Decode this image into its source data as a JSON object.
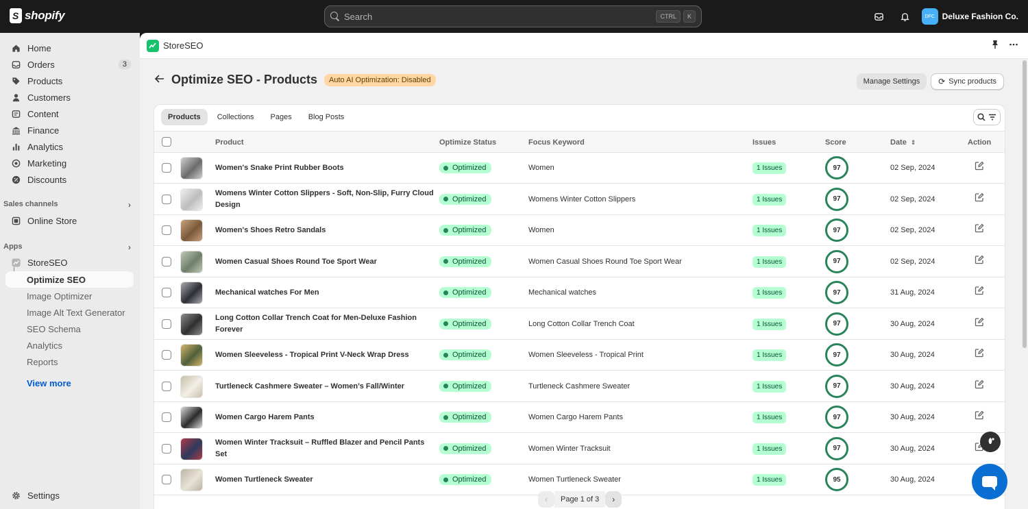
{
  "topbar": {
    "brand": "shopify",
    "search_placeholder": "Search",
    "shortcut_ctrl": "CTRL",
    "shortcut_k": "K",
    "store_initials": "DFC",
    "store_name": "Deluxe Fashion Co."
  },
  "sidebar": {
    "main": [
      {
        "label": "Home",
        "icon": "home-icon"
      },
      {
        "label": "Orders",
        "icon": "orders-icon",
        "count": "3"
      },
      {
        "label": "Products",
        "icon": "tag-icon"
      },
      {
        "label": "Customers",
        "icon": "person-icon"
      },
      {
        "label": "Content",
        "icon": "content-icon"
      },
      {
        "label": "Finance",
        "icon": "bank-icon"
      },
      {
        "label": "Analytics",
        "icon": "bar-chart-icon"
      },
      {
        "label": "Marketing",
        "icon": "target-icon"
      },
      {
        "label": "Discounts",
        "icon": "discount-icon"
      }
    ],
    "sales_channels_label": "Sales channels",
    "online_store": "Online Store",
    "apps_label": "Apps",
    "app_name": "StoreSEO",
    "app_sub": [
      "Optimize SEO",
      "Image Optimizer",
      "Image Alt Text Generator",
      "SEO Schema",
      "Analytics",
      "Reports"
    ],
    "view_more": "View more",
    "settings": "Settings"
  },
  "app_header": {
    "name": "StoreSEO"
  },
  "page": {
    "title": "Optimize SEO - Products",
    "badge": "Auto AI Optimization: Disabled",
    "manage_settings": "Manage Settings",
    "sync_products": "Sync products"
  },
  "tabs": [
    "Products",
    "Collections",
    "Pages",
    "Blog Posts"
  ],
  "table": {
    "headers": {
      "product": "Product",
      "status": "Optimize Status",
      "keyword": "Focus Keyword",
      "issues": "Issues",
      "score": "Score",
      "date": "Date",
      "action": "Action"
    },
    "rows": [
      {
        "name": "Women's Snake Print Rubber Boots",
        "status": "Optimized",
        "keyword": "Women",
        "issues": "1 Issues",
        "score": "97",
        "date": "02 Sep, 2024"
      },
      {
        "name": "Womens Winter Cotton Slippers - Soft, Non-Slip, Furry Cloud Design",
        "status": "Optimized",
        "keyword": "Womens Winter Cotton Slippers",
        "issues": "1 Issues",
        "score": "97",
        "date": "02 Sep, 2024"
      },
      {
        "name": "Women's Shoes Retro Sandals",
        "status": "Optimized",
        "keyword": "Women",
        "issues": "1 Issues",
        "score": "97",
        "date": "02 Sep, 2024"
      },
      {
        "name": "Women Casual Shoes Round Toe Sport Wear",
        "status": "Optimized",
        "keyword": "Women Casual Shoes Round Toe Sport Wear",
        "issues": "1 Issues",
        "score": "97",
        "date": "02 Sep, 2024"
      },
      {
        "name": "Mechanical watches For Men",
        "status": "Optimized",
        "keyword": "Mechanical watches",
        "issues": "1 Issues",
        "score": "97",
        "date": "31 Aug, 2024"
      },
      {
        "name": "Long Cotton Collar Trench Coat for Men-Deluxe Fashion Forever",
        "status": "Optimized",
        "keyword": "Long Cotton Collar Trench Coat",
        "issues": "1 Issues",
        "score": "97",
        "date": "30 Aug, 2024"
      },
      {
        "name": "Women Sleeveless - Tropical Print V-Neck Wrap Dress",
        "status": "Optimized",
        "keyword": "Women Sleeveless - Tropical Print",
        "issues": "1 Issues",
        "score": "97",
        "date": "30 Aug, 2024"
      },
      {
        "name": "Turtleneck Cashmere Sweater – Women’s Fall/Winter",
        "status": "Optimized",
        "keyword": "Turtleneck Cashmere Sweater",
        "issues": "1 Issues",
        "score": "97",
        "date": "30 Aug, 2024"
      },
      {
        "name": "Women Cargo Harem Pants",
        "status": "Optimized",
        "keyword": "Women Cargo Harem Pants",
        "issues": "1 Issues",
        "score": "97",
        "date": "30 Aug, 2024"
      },
      {
        "name": "Women Winter Tracksuit – Ruffled Blazer and Pencil Pants Set",
        "status": "Optimized",
        "keyword": "Women Winter Tracksuit",
        "issues": "1 Issues",
        "score": "97",
        "date": "30 Aug, 2024"
      },
      {
        "name": "Women Turtleneck Sweater",
        "status": "Optimized",
        "keyword": "Women Turtleneck Sweater",
        "issues": "1 Issues",
        "score": "95",
        "date": "30 Aug, 2024"
      }
    ]
  },
  "pagination": {
    "text": "Page 1 of 3"
  },
  "colors": {
    "accent_green": "#29845a",
    "badge_orange": "#ffd6a4",
    "link_blue": "#005bd3",
    "chat_blue": "#0a6fd3"
  }
}
